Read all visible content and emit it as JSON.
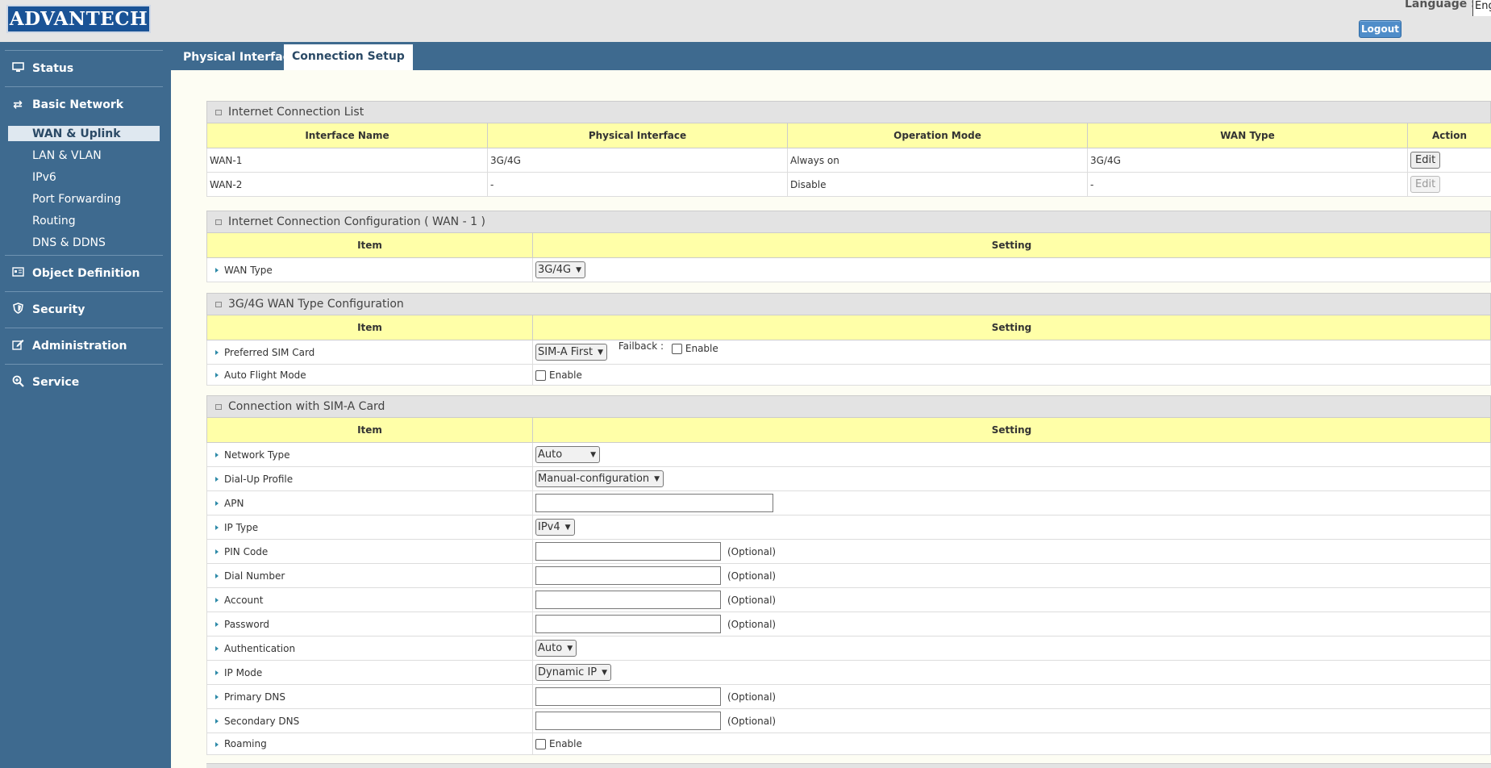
{
  "header": {
    "logo_text": "ADVANTECH",
    "language_label": "Language :",
    "language_value": "Eng",
    "logout_label": "Logout"
  },
  "sidebar": {
    "groups": [
      {
        "label": "Status",
        "icon": "monitor-icon"
      },
      {
        "label": "Basic Network",
        "icon": "swap-arrows-icon"
      },
      {
        "label": "Object Definition",
        "icon": "id-card-icon"
      },
      {
        "label": "Security",
        "icon": "shield-icon"
      },
      {
        "label": "Administration",
        "icon": "edit-icon"
      },
      {
        "label": "Service",
        "icon": "magnify-plus-icon"
      }
    ],
    "subitems": [
      {
        "label": "WAN & Uplink",
        "active": true
      },
      {
        "label": "LAN & VLAN"
      },
      {
        "label": "IPv6"
      },
      {
        "label": "Port Forwarding"
      },
      {
        "label": "Routing"
      },
      {
        "label": "DNS & DDNS"
      }
    ]
  },
  "tabs": [
    {
      "label": "Physical Interface",
      "active": false
    },
    {
      "label": "Connection Setup",
      "active": true
    }
  ],
  "connection_list": {
    "title": "Internet Connection List",
    "headers": [
      "Interface Name",
      "Physical Interface",
      "Operation Mode",
      "WAN Type",
      "Action"
    ],
    "rows": [
      {
        "name": "WAN-1",
        "physical": "3G/4G",
        "mode": "Always on",
        "wan_type": "3G/4G",
        "action": "Edit"
      },
      {
        "name": "WAN-2",
        "physical": "-",
        "mode": "Disable",
        "wan_type": "-",
        "action": "Edit"
      }
    ]
  },
  "wan_config": {
    "title": "Internet Connection Configuration ( WAN - 1 )",
    "headers": [
      "Item",
      "Setting"
    ],
    "wan_type_label": "WAN Type",
    "wan_type_value": "3G/4G"
  },
  "type_config": {
    "title": "3G/4G WAN Type Configuration",
    "headers": [
      "Item",
      "Setting"
    ],
    "preferred_sim_label": "Preferred SIM Card",
    "preferred_sim_value": "SIM-A First",
    "failback_label": "Failback :",
    "enable_label": "Enable",
    "auto_flight_label": "Auto Flight Mode"
  },
  "sim_a": {
    "title": "Connection with SIM-A Card",
    "headers": [
      "Item",
      "Setting"
    ],
    "optional": "(Optional)",
    "enable_label": "Enable",
    "network_type_label": "Network Type",
    "network_type_value": "Auto",
    "dialup_label": "Dial-Up Profile",
    "dialup_value": "Manual-configuration",
    "apn_label": "APN",
    "ip_type_label": "IP Type",
    "ip_type_value": "IPv4",
    "pin_label": "PIN Code",
    "dial_number_label": "Dial Number",
    "account_label": "Account",
    "password_label": "Password",
    "auth_label": "Authentication",
    "auth_value": "Auto",
    "ip_mode_label": "IP Mode",
    "ip_mode_value": "Dynamic IP",
    "primary_dns_label": "Primary DNS",
    "secondary_dns_label": "Secondary DNS",
    "roaming_label": "Roaming"
  },
  "colors": {
    "sidebar": "#3e6a8f",
    "header_bg": "#e5e5e5",
    "table_header": "#ffffa8",
    "logo": "#1a5396",
    "logout": "#4f8dc9"
  }
}
